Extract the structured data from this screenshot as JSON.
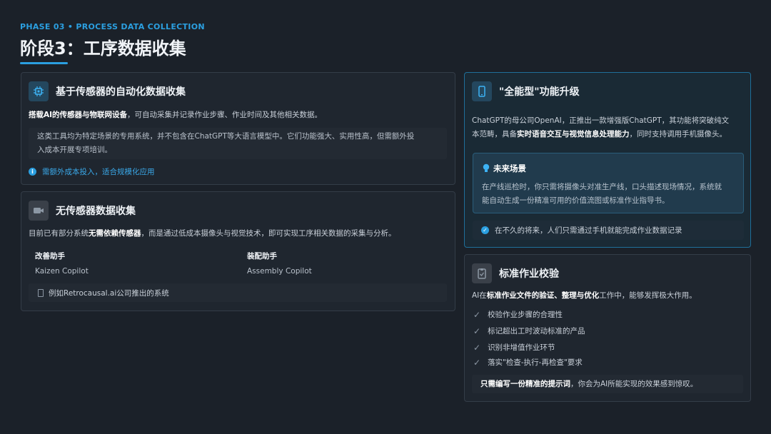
{
  "header": {
    "eyebrow": "PHASE 03 • PROCESS DATA COLLECTION",
    "title": "阶段3：工序数据收集"
  },
  "sensor_card": {
    "title": "基于传感器的自动化数据收集",
    "icon": "chip-icon",
    "intro_bold": "搭载AI的传感器与物联网设备",
    "intro_rest": "，可自动采集并记录作业步骤、作业时间及其他相关数据。",
    "note_line1": "这类工具均为特定场景的专用系统，并不包含在ChatGPT等大语言模型中。它们功能强大、实用性高，但需额外投",
    "note_line2": "入成本开展专项培训。",
    "info": "需额外成本投入，适合规模化应用",
    "accent": "#2b9fe0"
  },
  "nosensor_card": {
    "title": "无传感器数据收集",
    "icon": "camera-icon",
    "intro_pre": "目前已有部分系统",
    "intro_bold": "无需依赖传感器",
    "intro_rest": "，而是通过低成本摄像头与视觉技术，即可实现工序相关数据的采集与分析。",
    "col1_title": "改善助手",
    "col1_sub": "Kaizen Copilot",
    "col2_title": "装配助手",
    "col2_sub": "Assembly Copilot",
    "example": "例如Retrocausal.ai公司推出的系统"
  },
  "upgrade_card": {
    "title": "\"全能型\"功能升级",
    "icon": "phone-icon",
    "para_line1": "ChatGPT的母公司OpenAI，正推出一款增强版ChatGPT，其功能将突破纯文",
    "para_line2_pre": "本范畴，具备",
    "para_line2_bold": "实时语音交互与视觉信息处理能力",
    "para_line2_rest": "，同时支持调用手机摄像头。",
    "future_title": "未来场景",
    "future_icon": "lightbulb-icon",
    "future_line1": "在产线巡检时，你只需将摄像头对准生产线，口头描述现场情况，系统就",
    "future_line2": "能自动生成一份精准可用的价值流图或标准作业指导书。",
    "info": "在不久的将来，人们只需通过手机就能完成作业数据记录"
  },
  "standard_card": {
    "title": "标准作业校验",
    "icon": "clipboard-icon",
    "intro_pre": "AI在",
    "intro_bold": "标准作业文件的验证、整理与优化",
    "intro_rest": "工作中，能够发挥极大作用。",
    "checks": [
      "校验作业步骤的合理性",
      "标记超出工时波动标准的产品",
      "识别非增值作业环节",
      "落实\"检查-执行-再检查\"要求"
    ],
    "footer_bold": "只需编写一份精准的提示词",
    "footer_rest": "，你会为AI所能实现的效果感到惊叹。"
  }
}
